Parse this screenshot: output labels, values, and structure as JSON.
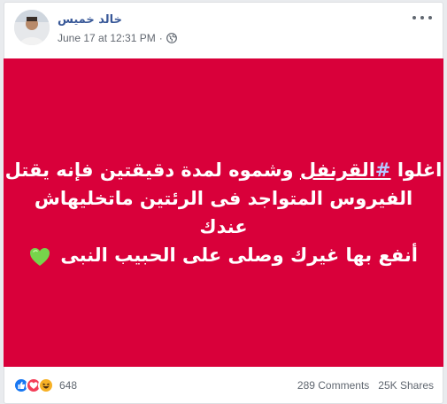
{
  "post": {
    "author": "خالد خميس",
    "timestamp": "June 17 at 12:31 PM",
    "separator": "·",
    "privacy_icon": "globe-icon",
    "options_icon": "more-icon"
  },
  "image": {
    "background": "#d9003a",
    "line1_pre": "اغلوا ",
    "line1_hash": "#",
    "line1_tag": "القرنفل",
    "line1_post": " وشموه لمدة دقيقتين فإنه يقتل",
    "line2": "الفيروس المتواجد فى الرئتين ماتخليهاش",
    "line3": "عندك",
    "line4": "أنفع بها غيرك وصلى على الحبيب النبى",
    "heart": "green-heart-icon"
  },
  "footer": {
    "reactions": [
      "like-icon",
      "love-icon",
      "haha-icon"
    ],
    "reaction_count": "648",
    "comments": "289 Comments",
    "shares": "25K Shares"
  }
}
